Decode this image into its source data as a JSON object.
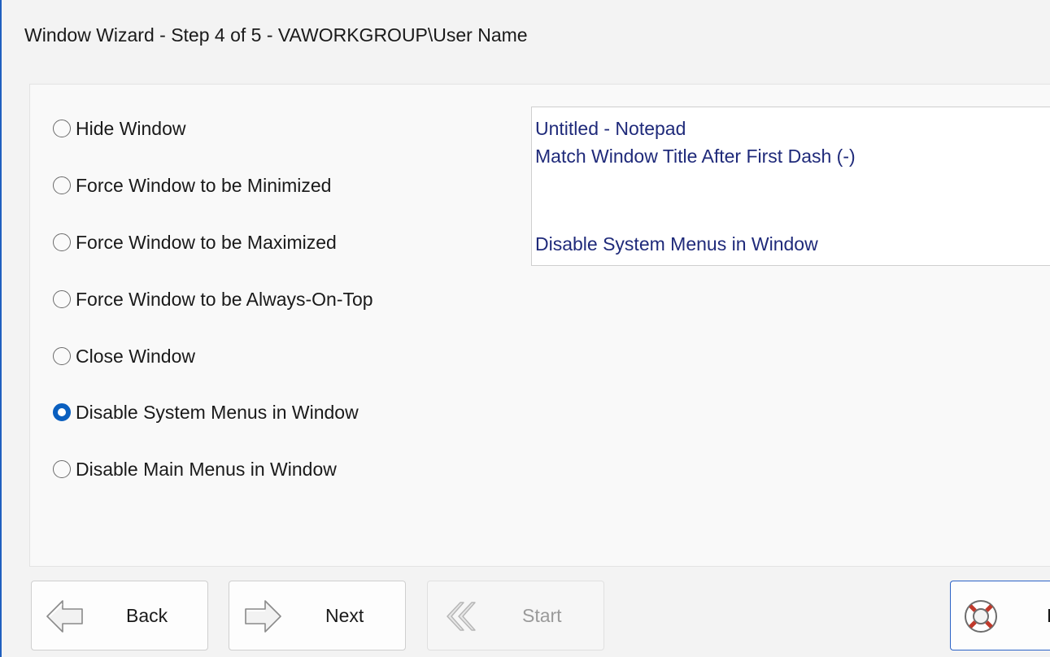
{
  "window": {
    "title": "Window Wizard - Step 4 of 5 - VAWORKGROUP\\User Name"
  },
  "options": [
    {
      "label": "Hide Window",
      "selected": false
    },
    {
      "label": "Force Window to be Minimized",
      "selected": false
    },
    {
      "label": "Force Window to be Maximized",
      "selected": false
    },
    {
      "label": "Force Window to be Always-On-Top",
      "selected": false
    },
    {
      "label": "Close Window",
      "selected": false
    },
    {
      "label": "Disable System Menus in Window",
      "selected": true
    },
    {
      "label": "Disable Main Menus in Window",
      "selected": false
    }
  ],
  "summary": {
    "line1": "Untitled - Notepad",
    "line2": "Match Window Title After First Dash (-)",
    "line3": "Disable System Menus in Window"
  },
  "buttons": {
    "back": {
      "label": "Back",
      "icon": "arrow-left-icon"
    },
    "next": {
      "label": "Next",
      "icon": "arrow-right-icon"
    },
    "start": {
      "label": "Start",
      "icon": "double-chevron-left-icon",
      "disabled": true
    },
    "help": {
      "label": "H",
      "icon": "lifebuoy-icon"
    }
  },
  "colors": {
    "accent": "#0a5fbf",
    "summary_text": "#1f2a7a",
    "window_border": "#1f5fbf"
  }
}
